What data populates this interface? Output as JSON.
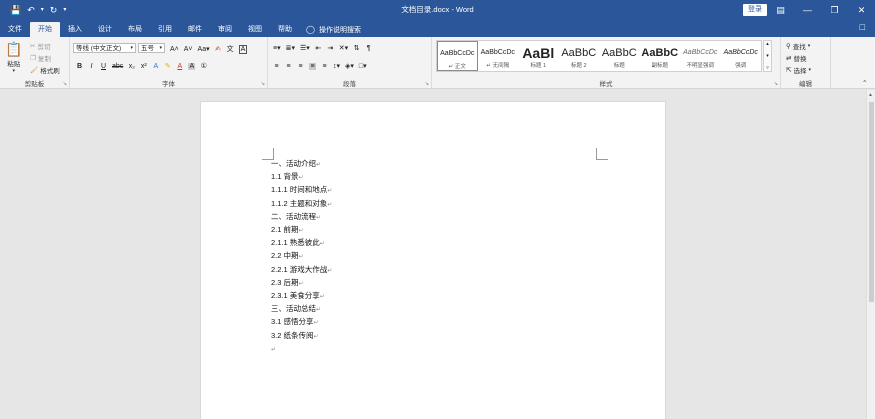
{
  "window": {
    "title": "文档目录.docx - Word",
    "login_label": "登录"
  },
  "tabs": [
    "文件",
    "开始",
    "插入",
    "设计",
    "布局",
    "引用",
    "邮件",
    "审阅",
    "视图",
    "帮助"
  ],
  "tell_me": "操作说明搜索",
  "ribbon": {
    "clipboard": {
      "paste_label": "粘贴",
      "cut_label": "剪切",
      "copy_label": "复制",
      "format_painter_label": "格式刷",
      "group_label": "剪贴板"
    },
    "font": {
      "font_name": "等线 (中文正文)",
      "font_size": "五号",
      "group_label": "字体"
    },
    "paragraph": {
      "group_label": "段落"
    },
    "styles": {
      "group_label": "样式",
      "items": [
        {
          "preview": "AaBbCcDc",
          "name": "↵ 正文"
        },
        {
          "preview": "AaBbCcDc",
          "name": "↵ 无间隔"
        },
        {
          "preview": "AaBl",
          "name": "标题 1"
        },
        {
          "preview": "AaBbC",
          "name": "标题 2"
        },
        {
          "preview": "AaBbC",
          "name": "标题"
        },
        {
          "preview": "AaBbC",
          "name": "副标题"
        },
        {
          "preview": "AaBbCcDc",
          "name": "不明显强调"
        },
        {
          "preview": "AaBbCcDc",
          "name": "强调"
        }
      ]
    },
    "editing": {
      "find_label": "查找",
      "replace_label": "替换",
      "select_label": "选择",
      "group_label": "编辑"
    }
  },
  "document": {
    "lines": [
      "一、活动介绍",
      "1.1 背景",
      "1.1.1 时间和地点",
      "1.1.2 主题和对象",
      "二、活动流程",
      "2.1 前期",
      "2.1.1 熟悉彼此",
      "2.2 中期",
      "2.2.1 游戏大作战",
      "2.3 后期",
      "2.3.1 美食分享",
      "三、活动总结",
      "3.1 感悟分享",
      "3.2 纸条传阅"
    ]
  },
  "colors": {
    "accent": "#2b579a",
    "ribbon_bg": "#f3f3f3",
    "doc_bg": "#e6e6e6"
  }
}
